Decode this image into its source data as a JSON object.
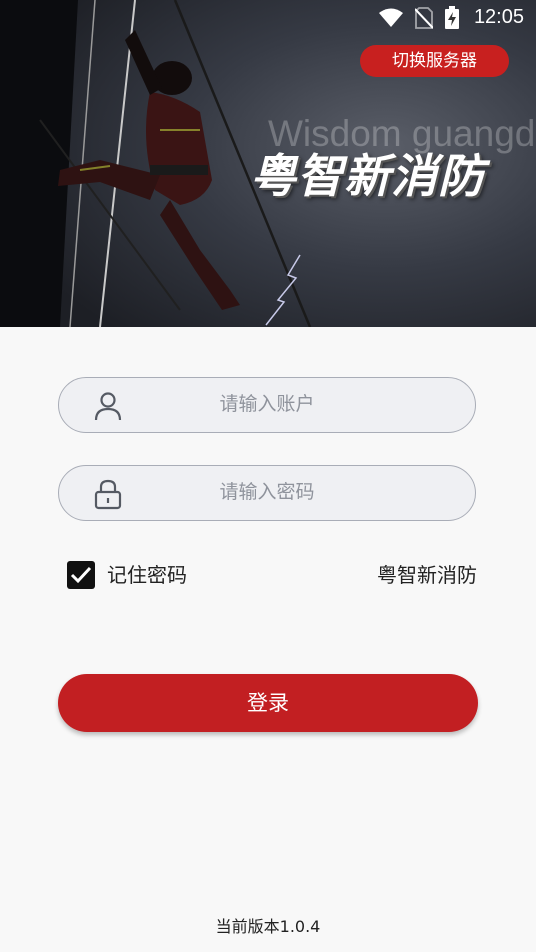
{
  "status_bar": {
    "time": "12:05",
    "icons": [
      "wifi-icon",
      "no-sim-icon",
      "battery-charging-icon"
    ]
  },
  "banner": {
    "switch_server_label": "切换服务器",
    "watermark_text": "Wisdom guangdong",
    "brand_title": "粤智新消防"
  },
  "login_form": {
    "account_placeholder": "请输入账户",
    "password_placeholder": "请输入密码",
    "account_icon": "user-icon",
    "password_icon": "lock-icon",
    "remember_label": "记住密码",
    "remember_checked": true,
    "brand_label": "粤智新消防",
    "login_label": "登录"
  },
  "footer": {
    "version_text": "当前版本1.0.4"
  },
  "colors": {
    "accent": "#c21f22",
    "field_bg": "#eff0f3",
    "field_border": "#a9adb7",
    "page_bg": "#f8f8f8"
  }
}
